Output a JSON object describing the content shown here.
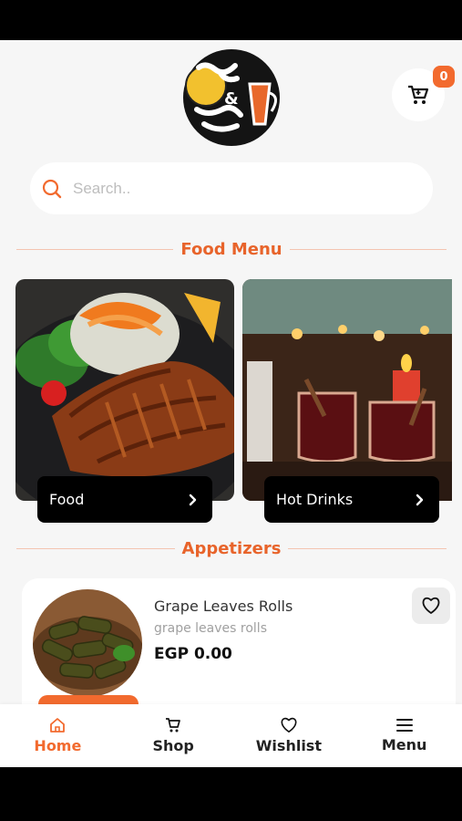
{
  "header": {
    "logo_name": "brand-logo",
    "cart_count": "0"
  },
  "search": {
    "placeholder": "Search.."
  },
  "sections": {
    "food_menu": "Food Menu",
    "appetizers": "Appetizers"
  },
  "categories": [
    {
      "label": "Food"
    },
    {
      "label": "Hot Drinks"
    }
  ],
  "products": [
    {
      "name": "Grape Leaves Rolls",
      "subtitle": "grape leaves rolls",
      "price": "EGP 0.00"
    }
  ],
  "nav": [
    {
      "label": "Home",
      "icon": "home-icon",
      "active": true
    },
    {
      "label": "Shop",
      "icon": "cart-icon"
    },
    {
      "label": "Wishlist",
      "icon": "heart-icon"
    },
    {
      "label": "Menu",
      "icon": "menu-icon"
    }
  ],
  "colors": {
    "accent": "#f26a2e",
    "accent_text": "#e8642b",
    "card_label": "#000000"
  }
}
